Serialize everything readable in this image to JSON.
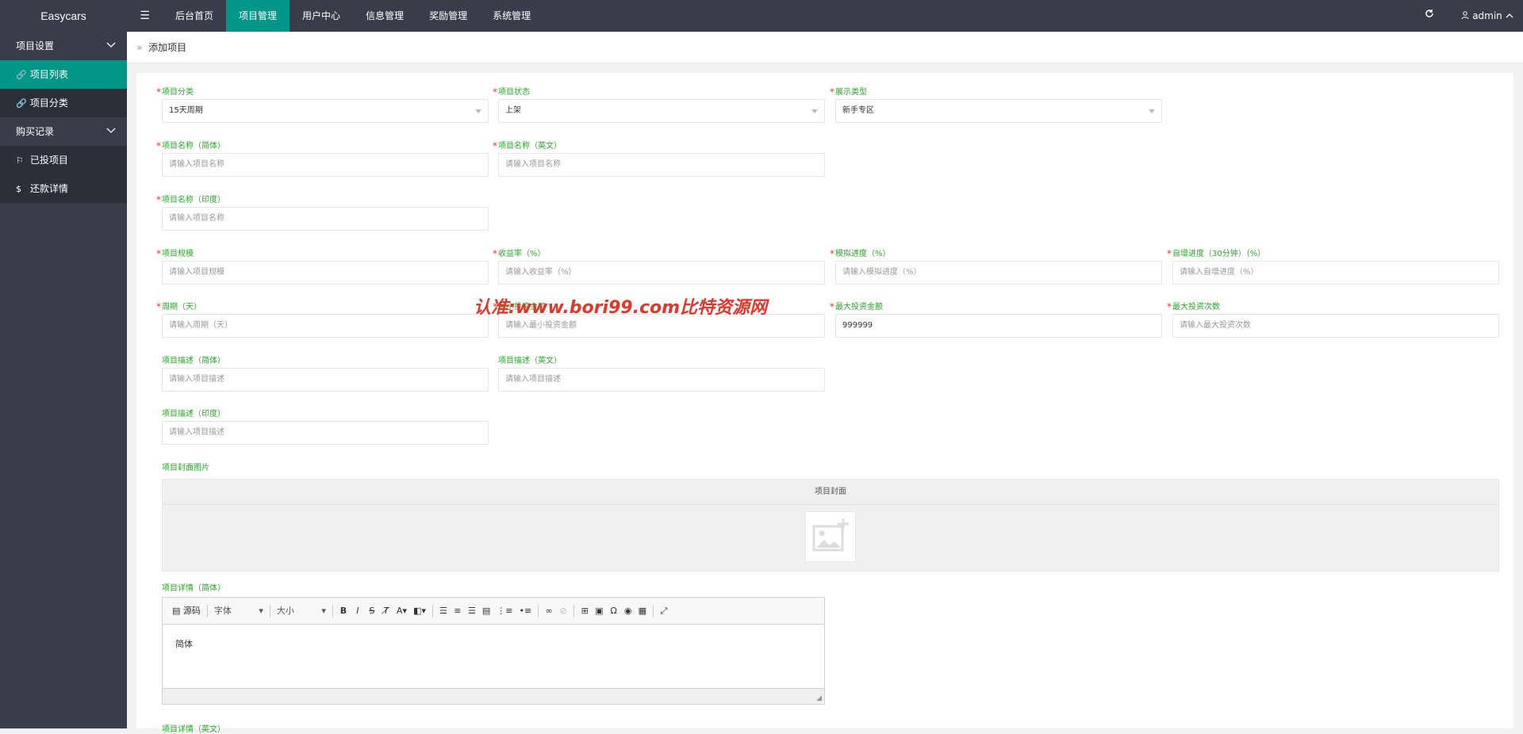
{
  "app": {
    "title": "Easycars",
    "menu_icon": "☰"
  },
  "nav": {
    "items": [
      "后台首页",
      "项目管理",
      "用户中心",
      "信息管理",
      "奖励管理",
      "系统管理"
    ],
    "active_index": 1
  },
  "header": {
    "refresh_icon": "refresh-icon",
    "user": "admin"
  },
  "sidebar": {
    "groups": [
      {
        "label": "项目设置",
        "items": [
          {
            "label": "项目列表",
            "active": true
          },
          {
            "label": "项目分类",
            "active": false
          }
        ]
      },
      {
        "label": "购买记录",
        "items": [
          {
            "label": "已投项目",
            "active": false
          },
          {
            "label": "还款详情",
            "active": false
          }
        ]
      }
    ]
  },
  "breadcrumb": {
    "current": "添加项目"
  },
  "form": {
    "category": {
      "label": "项目分类",
      "value": "15天周期"
    },
    "status": {
      "label": "项目状态",
      "value": "上架"
    },
    "display_type": {
      "label": "展示类型",
      "value": "新手专区"
    },
    "name_cn": {
      "label": "项目名称（简体）",
      "placeholder": "请输入项目名称"
    },
    "name_en": {
      "label": "项目名称（英文）",
      "placeholder": "请输入项目名称"
    },
    "name_in": {
      "label": "项目名称（印度）",
      "placeholder": "请输入项目名称"
    },
    "scale": {
      "label": "项目规模",
      "placeholder": "请输入项目规模"
    },
    "yield": {
      "label": "收益率（%）",
      "placeholder": "请输入收益率（%）"
    },
    "sim_progress": {
      "label": "模拟进度（%）",
      "placeholder": "请输入模拟进度（%）"
    },
    "auto_progress": {
      "label": "自增进度（30分钟）（%）",
      "placeholder": "请输入自增进度（%）"
    },
    "period": {
      "label": "周期（天）",
      "placeholder": "请输入周期（天）"
    },
    "min_invest": {
      "label": "最小投资金额",
      "placeholder": "请输入最小投资金额"
    },
    "max_invest": {
      "label": "最大投资金额",
      "value": "999999"
    },
    "max_times": {
      "label": "最大投资次数",
      "placeholder": "请输入最大投资次数"
    },
    "desc_cn": {
      "label": "项目描述（简体）",
      "placeholder": "请输入项目描述"
    },
    "desc_en": {
      "label": "项目描述（英文）",
      "placeholder": "请输入项目描述"
    },
    "desc_in": {
      "label": "项目描述（印度）",
      "placeholder": "请输入项目描述"
    },
    "cover": {
      "label": "项目封面图片",
      "box_title": "项目封面"
    },
    "detail_cn": {
      "label": "项目详情（简体）",
      "body": "简体"
    },
    "detail_en": {
      "label": "项目详情（英文）"
    }
  },
  "editor_toolbar": {
    "source": "源码",
    "font": "字体",
    "size": "大小"
  },
  "watermark": "认准:www.bori99.com比特资源网",
  "colors": {
    "accent": "#009688",
    "topbar": "#393d49",
    "label": "#2aa52a",
    "required": "#e33",
    "watermark": "#e0372c"
  }
}
